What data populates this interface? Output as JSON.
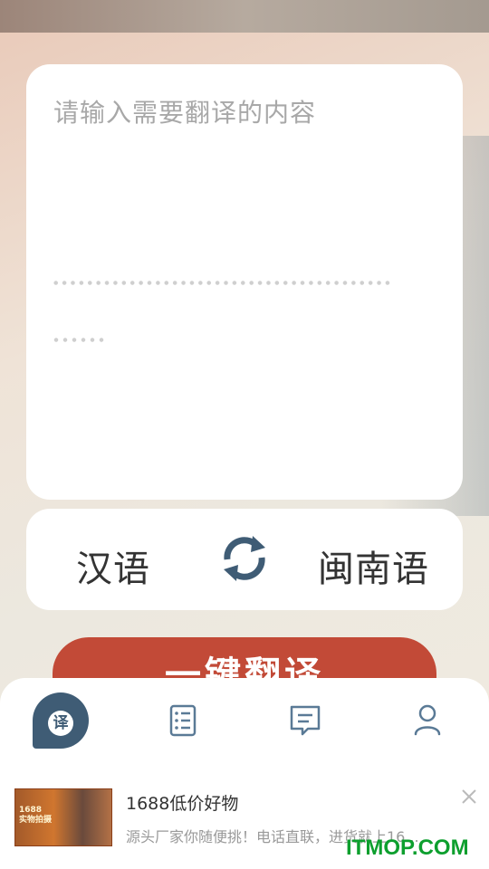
{
  "input": {
    "placeholder": "请输入需要翻译的内容"
  },
  "languages": {
    "source": "汉语",
    "target": "闽南语",
    "swap_icon": "swap-arrows-icon"
  },
  "actions": {
    "translate_label": "一键翻译"
  },
  "tabs": [
    {
      "id": "translate",
      "label": "译",
      "icon": "translate-icon",
      "active": true
    },
    {
      "id": "list",
      "icon": "checklist-icon",
      "active": false
    },
    {
      "id": "messages",
      "icon": "message-icon",
      "active": false
    },
    {
      "id": "profile",
      "icon": "person-icon",
      "active": false
    }
  ],
  "ad": {
    "title": "1688低价好物",
    "description": "源头厂家你随便挑！电话直联，进货就上16...",
    "thumb_text_line1": "1688",
    "thumb_text_line2": "实物拍摄",
    "close_icon": "close-icon"
  },
  "watermark": "ITMOP.COM",
  "colors": {
    "accent_blue": "#3f5c75",
    "button_red": "#c24a37",
    "watermark_green": "#0d9f2e"
  }
}
